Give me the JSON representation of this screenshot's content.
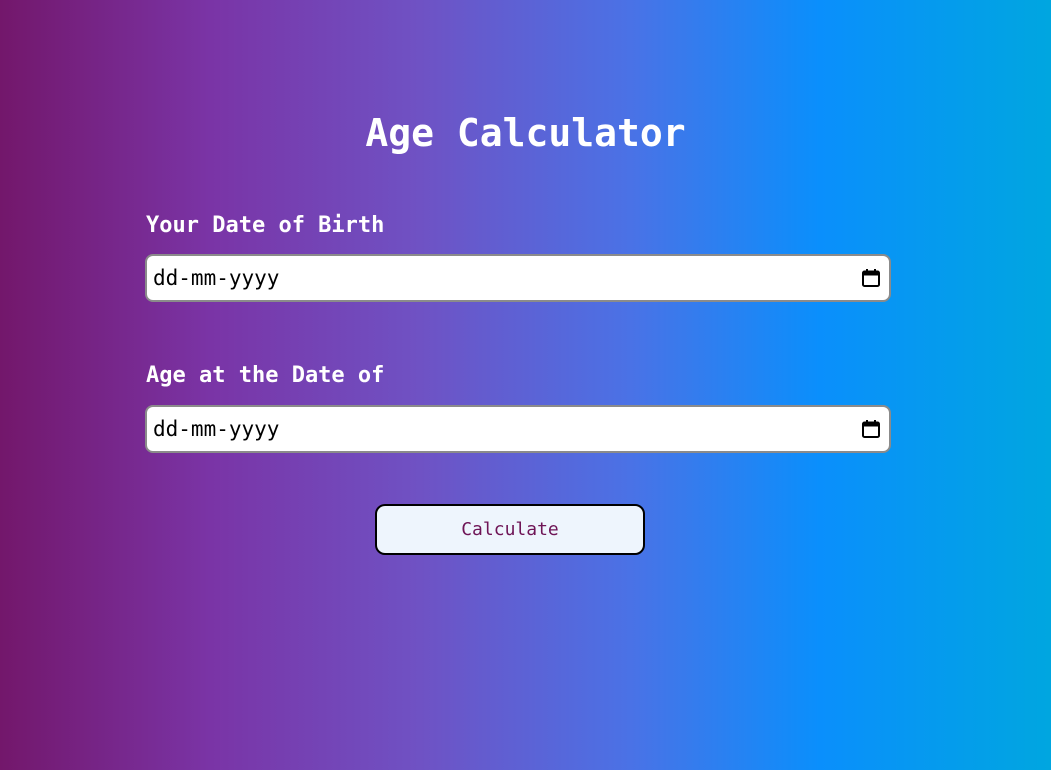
{
  "app": {
    "title": "Age Calculator"
  },
  "form": {
    "birth_label": "Your Date of Birth",
    "birth_placeholder": "dd-mm-yyyy",
    "target_label": "Age at the Date of",
    "target_placeholder": "dd-mm-yyyy",
    "calculate_label": "Calculate"
  },
  "icons": {
    "date_picker": "calendar-icon"
  },
  "colors": {
    "gradient_start": "#73176b",
    "gradient_end": "#00a6e0",
    "button_text": "#6e1456",
    "button_bg": "#eef5fd"
  }
}
